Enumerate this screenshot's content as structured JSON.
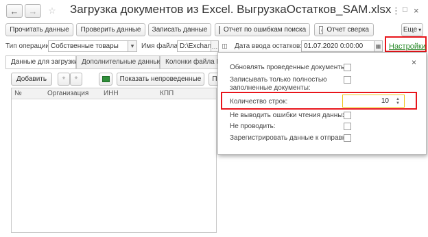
{
  "window": {
    "title": "Загрузка документов из Excel. ВыгрузкаОстатков_SAM.xlsx",
    "back_icon": "arrow-left",
    "forward_icon": "arrow-right",
    "menu_icon": "⋮",
    "maximize_icon": "□",
    "close_icon": "×"
  },
  "toolbar": {
    "read_data": "Прочитать данные",
    "check_data": "Проверить данные",
    "write_data": "Записать данные",
    "error_report": "Отчет по ошибкам поиска",
    "reconcile_report": "Отчет сверка",
    "more": "Еще",
    "more_arrow": "▾"
  },
  "fields": {
    "op_type_label": "Тип операции:",
    "op_type_value": "Собственные товары",
    "file_label": "Имя файла:",
    "file_value": "D:\\Exchange",
    "date_label": "Дата ввода остатков:",
    "date_value": "01.07.2020  0:00:00",
    "settings_link": "Настройки"
  },
  "tabs": [
    {
      "label": "Данные для загрузки"
    },
    {
      "label": "Дополнительные данные"
    },
    {
      "label": "Колонки файла Exc"
    }
  ],
  "grid_toolbar": {
    "add": "Добавить",
    "show_unprocessed": "Показать непроведенные",
    "cut_button": "П"
  },
  "grid": {
    "columns": [
      "№",
      "Организация",
      "ИНН",
      "КПП"
    ]
  },
  "settings_popup": {
    "close": "×",
    "update_posted": "Обновлять проведенные документы:",
    "write_full_line1": "Записывать только полностью",
    "write_full_line2": "заполненные документы:",
    "row_count_label": "Количество строк:",
    "row_count_value": "10",
    "no_read_errors": "Не выводить ошибки чтения данных:",
    "no_posting": "Не проводить:",
    "register_send": "Зарегистрировать данные к отправке:",
    "colors": {
      "highlight_border": "#e8151b",
      "active_field_border": "#f0c419",
      "link": "#2a8a2a"
    }
  }
}
